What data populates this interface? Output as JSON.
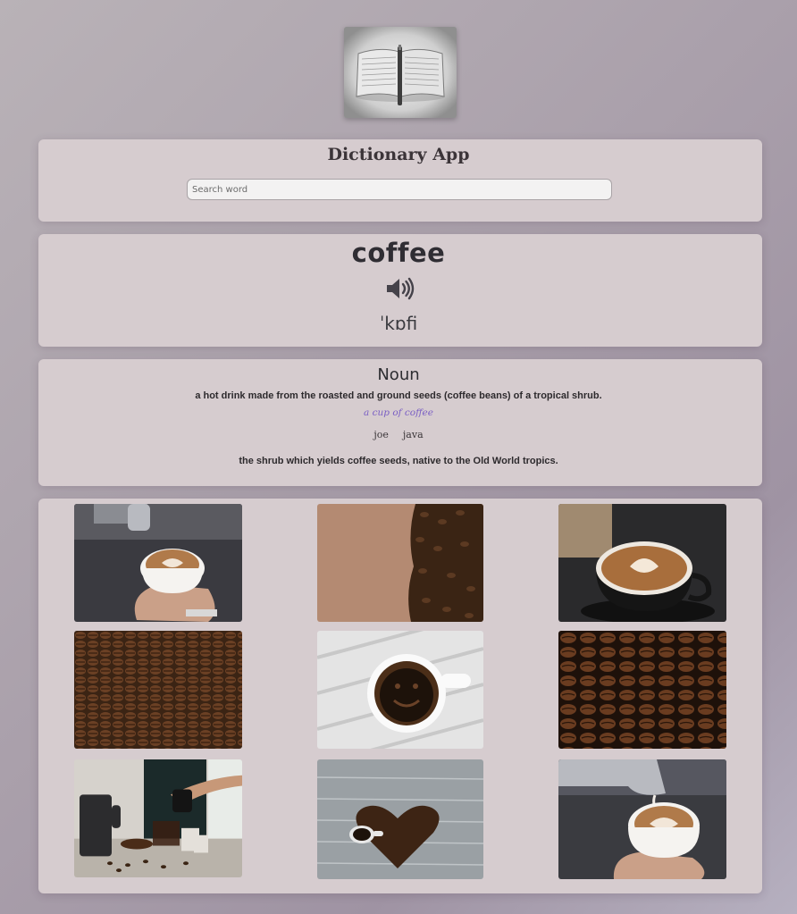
{
  "app": {
    "title": "Dictionary App"
  },
  "search": {
    "placeholder": "Search word",
    "value": ""
  },
  "entry": {
    "word": "coffee",
    "phonetic": "ˈkɒfi",
    "audio_icon": "speaker-icon",
    "meanings": [
      {
        "part_of_speech": "Noun",
        "definitions": [
          {
            "text": "a hot drink made from the roasted and ground seeds (coffee beans) of a tropical shrub.",
            "example": "a cup of coffee",
            "synonyms": [
              "joe",
              "java"
            ]
          },
          {
            "text": "the shrub which yields coffee seeds, native to the Old World tropics."
          }
        ]
      }
    ]
  },
  "gallery": {
    "images": [
      "latte-pour-photo",
      "coffee-beans-on-tan-photo",
      "latte-art-cup-photo",
      "roasted-beans-pile-photo",
      "black-coffee-smiley-photo",
      "coffee-beans-closeup-photo",
      "coffee-table-setup-photo",
      "bean-heart-with-cup-photo",
      "milk-pour-latte-photo"
    ]
  },
  "colors": {
    "card": "#d6cccf",
    "accent_example": "#7a5fc4",
    "text_dark": "#2d2a2d"
  }
}
